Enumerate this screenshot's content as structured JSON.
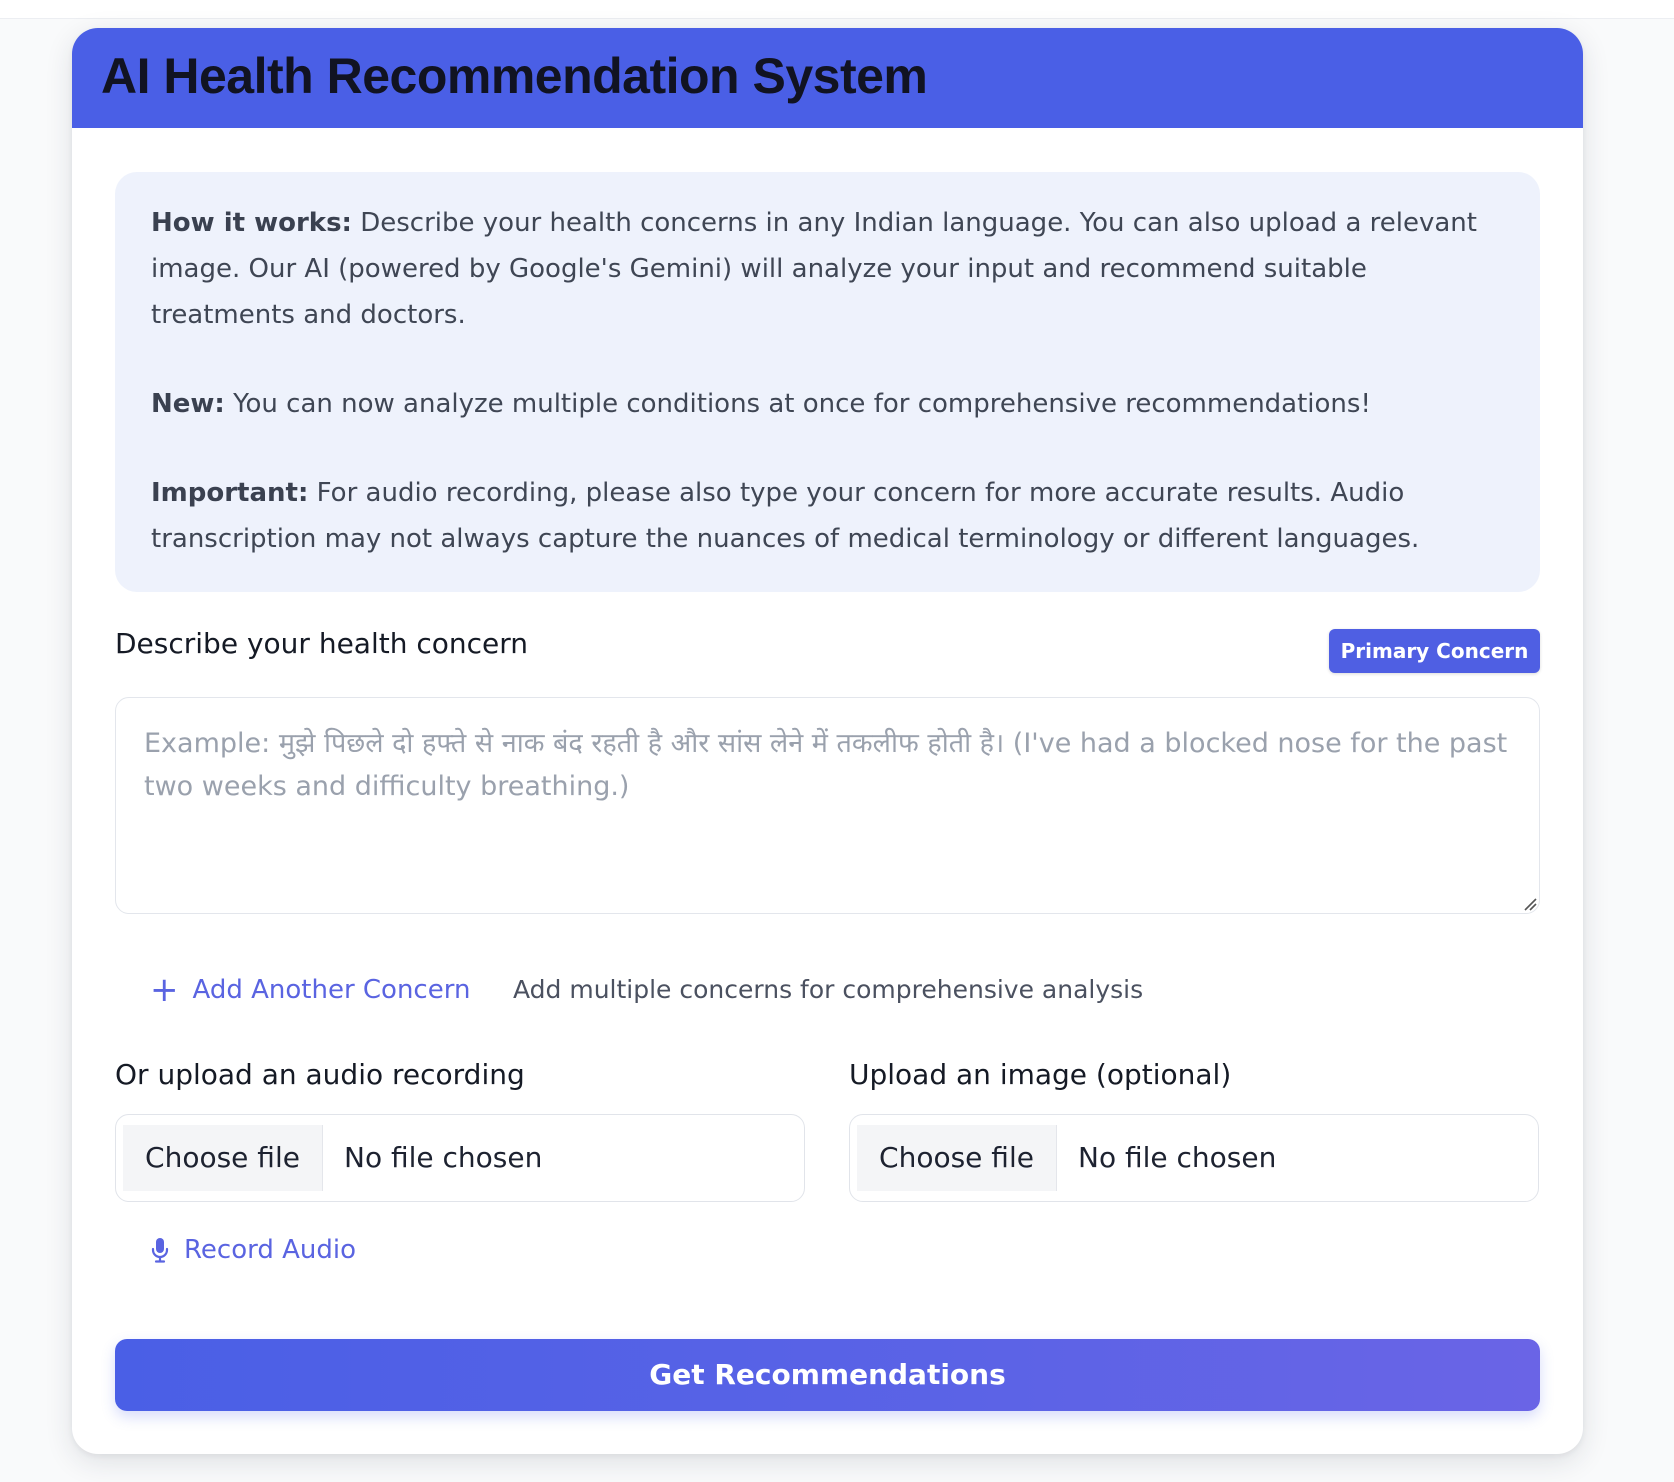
{
  "header": {
    "title": "AI Health Recommendation System"
  },
  "info": {
    "how_label": "How it works:",
    "how_text": " Describe your health concerns in any Indian language. You can also upload a relevant image. Our AI (powered by Google's Gemini) will analyze your input and recommend suitable treatments and doctors.",
    "new_label": "New:",
    "new_text": " You can now analyze multiple conditions at once for comprehensive recommendations!",
    "important_label": "Important:",
    "important_text": " For audio recording, please also type your concern for more accurate results. Audio transcription may not always capture the nuances of medical terminology or different languages."
  },
  "concern": {
    "label": "Describe your health concern",
    "badge": "Primary Concern",
    "value": "",
    "placeholder": "Example: मुझे पिछले दो हफ्ते से नाक बंद रहती है और सांस लेने में तकलीफ होती है। (I've had a blocked nose for the past two weeks and difficulty breathing.)"
  },
  "add_concern": {
    "icon": "plus-icon",
    "label": "Add Another Concern",
    "hint": "Add multiple concerns for comprehensive analysis"
  },
  "audio_upload": {
    "label": "Or upload an audio recording",
    "button": "Choose file",
    "status": "No file chosen"
  },
  "image_upload": {
    "label": "Upload an image (optional)",
    "button": "Choose file",
    "status": "No file chosen"
  },
  "record": {
    "icon": "microphone-icon",
    "label": "Record Audio"
  },
  "submit": {
    "label": "Get Recommendations"
  },
  "colors": {
    "primary": "#4a5fe6",
    "link": "#5a64e1",
    "info_bg": "#eef2fc",
    "title_text": "#111322"
  }
}
